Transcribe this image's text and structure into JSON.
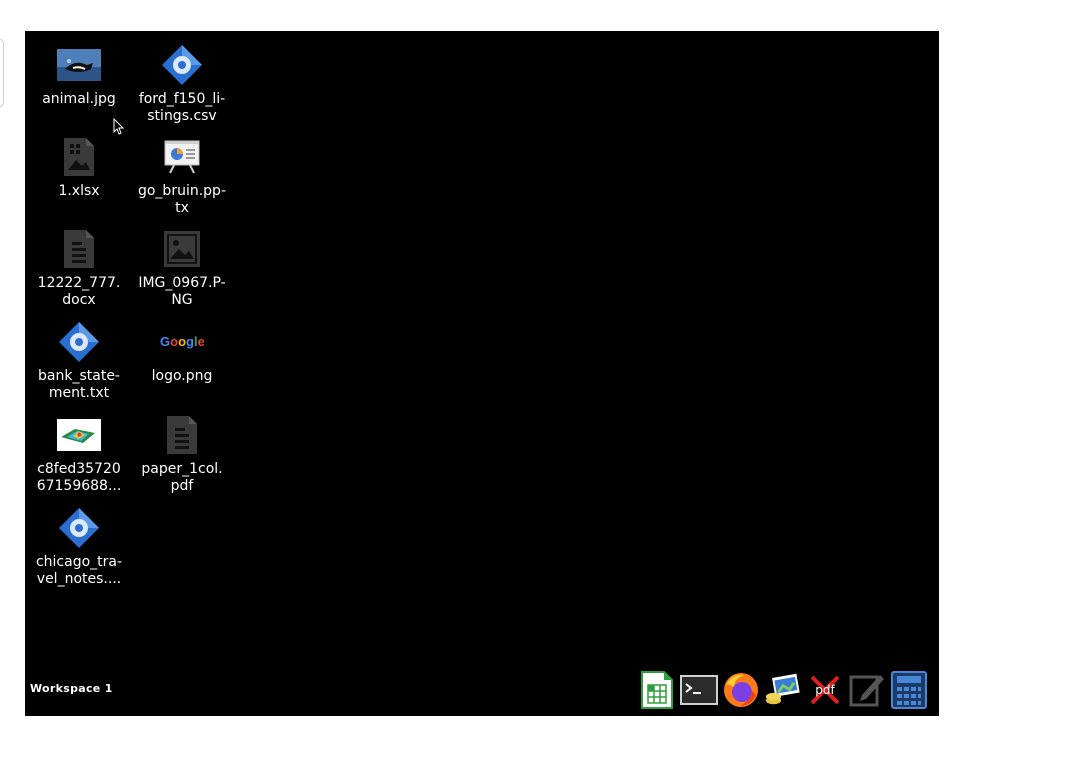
{
  "desktop": {
    "workspace_label": "Workspace 1",
    "icons": [
      {
        "label": "animal.jpg",
        "icon": "photo-thumbnail-icon"
      },
      {
        "label": "ford_f150_li-\nstings.csv",
        "icon": "blue-gear-file-icon"
      },
      {
        "label": "1.xlsx",
        "icon": "spreadsheet-file-icon"
      },
      {
        "label": "go_bruin.pp-\ntx",
        "icon": "presentation-file-icon"
      },
      {
        "label": "12222_777.\ndocx",
        "icon": "document-file-icon"
      },
      {
        "label": "IMG_0967.P-\nNG",
        "icon": "image-file-icon"
      },
      {
        "label": "bank_state-\nment.txt",
        "icon": "blue-gear-file-icon"
      },
      {
        "label": "logo.png",
        "icon": "google-logo-thumbnail-icon"
      },
      {
        "label": "c8fed35720\n67159688...",
        "icon": "surface-plot-thumbnail-icon"
      },
      {
        "label": "paper_1col.\npdf",
        "icon": "document-file-icon"
      },
      {
        "label": "chicago_tra-\nvel_notes....",
        "icon": "blue-gear-file-icon"
      }
    ]
  },
  "taskbar": {
    "items": [
      {
        "name": "libreoffice-calc-icon"
      },
      {
        "name": "terminal-icon"
      },
      {
        "name": "firefox-icon"
      },
      {
        "name": "image-viewer-icon"
      },
      {
        "name": "pdf-tool-icon",
        "text": "pdf"
      },
      {
        "name": "text-editor-icon"
      },
      {
        "name": "calculator-icon"
      }
    ]
  }
}
